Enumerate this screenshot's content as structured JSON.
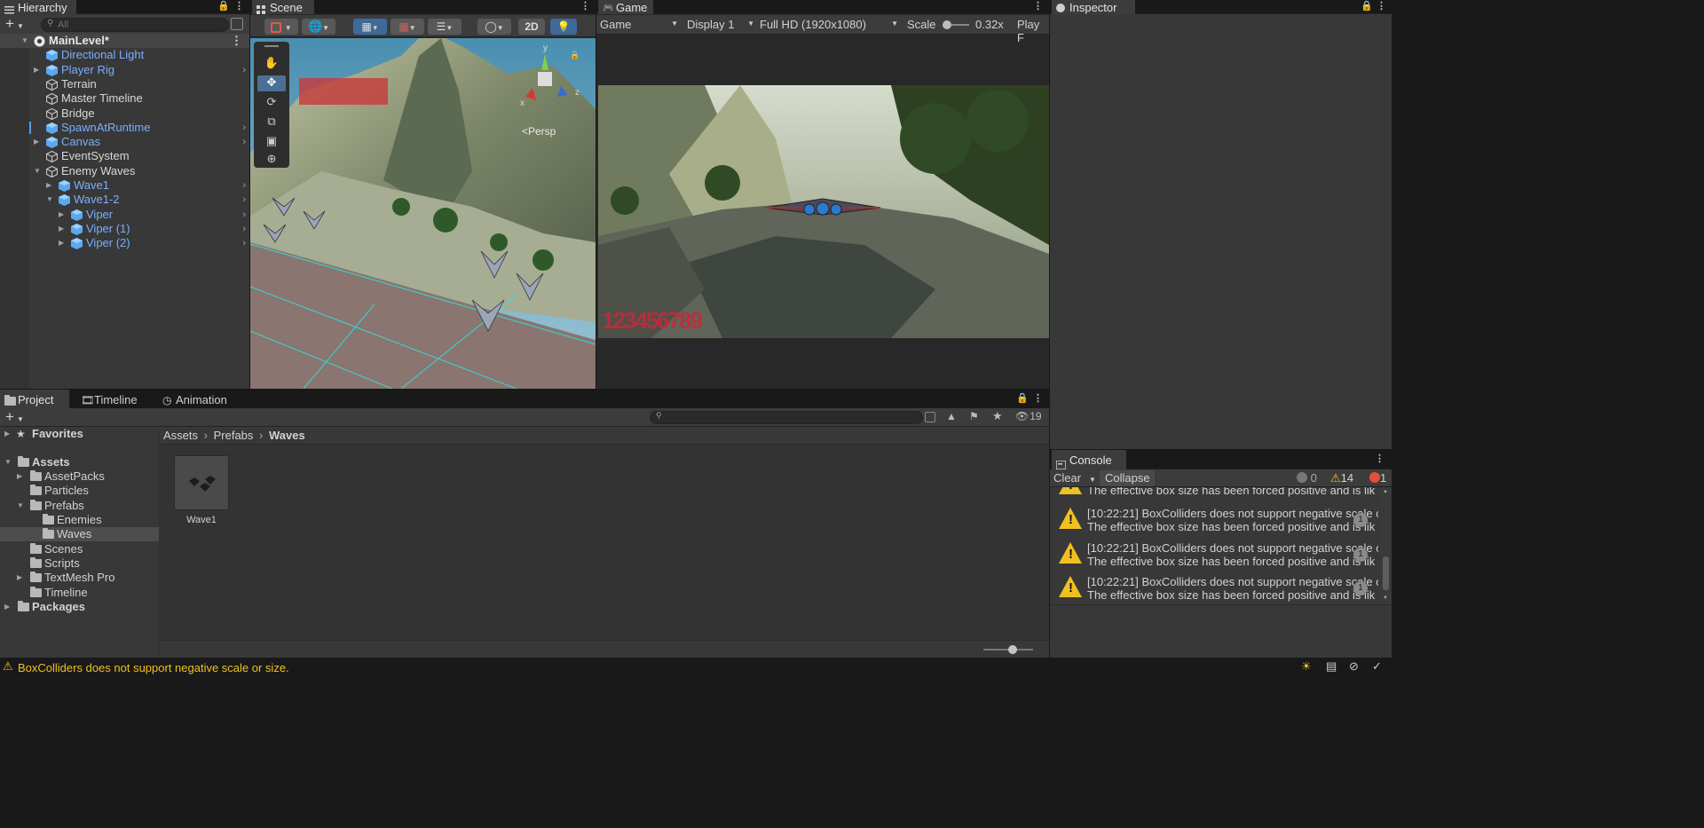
{
  "hierarchy": {
    "tab_label": "Hierarchy",
    "search_placeholder": "All",
    "add_label": "+",
    "items": [
      {
        "label": "MainLevel*",
        "color": "white"
      },
      {
        "label": "Directional Light",
        "color": "blue"
      },
      {
        "label": "Player Rig",
        "color": "blue"
      },
      {
        "label": "Terrain",
        "color": "white"
      },
      {
        "label": "Master Timeline",
        "color": "white"
      },
      {
        "label": "Bridge",
        "color": "white"
      },
      {
        "label": "SpawnAtRuntime",
        "color": "blue"
      },
      {
        "label": "Canvas",
        "color": "blue"
      },
      {
        "label": "EventSystem",
        "color": "white"
      },
      {
        "label": "Enemy Waves",
        "color": "white"
      },
      {
        "label": "Wave1",
        "color": "blue"
      },
      {
        "label": "Wave1-2",
        "color": "blue"
      },
      {
        "label": "Viper",
        "color": "blue"
      },
      {
        "label": "Viper (1)",
        "color": "blue"
      },
      {
        "label": "Viper (2)",
        "color": "blue"
      }
    ]
  },
  "scene": {
    "tab_label": "Scene",
    "btn_2d": "2D",
    "gizmo_persp": "<Persp",
    "gizmo_y": "y",
    "gizmo_x": "x",
    "gizmo_z": "z"
  },
  "game": {
    "tab_label": "Game",
    "mode": "Game",
    "display": "Display 1",
    "resolution": "Full HD (1920x1080)",
    "scale_label": "Scale",
    "scale_value": "0.32x",
    "play_label": "Play F",
    "hud_numbers": "123456789"
  },
  "inspector": {
    "tab_label": "Inspector"
  },
  "project": {
    "tabs": [
      "Project",
      "Timeline",
      "Animation"
    ],
    "hidden_count": "19",
    "favorites": "Favorites",
    "tree": [
      {
        "label": "Assets",
        "bold": true
      },
      {
        "label": "AssetPacks"
      },
      {
        "label": "Particles"
      },
      {
        "label": "Prefabs"
      },
      {
        "label": "Enemies"
      },
      {
        "label": "Waves"
      },
      {
        "label": "Scenes"
      },
      {
        "label": "Scripts"
      },
      {
        "label": "TextMesh Pro"
      },
      {
        "label": "Timeline"
      },
      {
        "label": "Packages",
        "bold": true
      }
    ],
    "breadcrumb": [
      "Assets",
      "Prefabs",
      "Waves"
    ],
    "asset_label": "Wave1"
  },
  "console": {
    "tab_label": "Console",
    "clear_label": "Clear",
    "collapse_label": "Collapse",
    "info_count": "0",
    "warn_count": "14",
    "error_count": "1",
    "top_partial": "The effective box size has been forced positive and is lik",
    "entries": [
      {
        "line1": "[10:22:21] BoxColliders does not support negative scale o",
        "line2": "The effective box size has been forced positive and is lik",
        "count": "1"
      },
      {
        "line1": "[10:22:21] BoxColliders does not support negative scale o",
        "line2": "The effective box size has been forced positive and is lik",
        "count": "1"
      },
      {
        "line1": "[10:22:21] BoxColliders does not support negative scale o",
        "line2": "The effective box size has been forced positive and is lik",
        "count": "1"
      }
    ]
  },
  "status": {
    "message": "BoxColliders does not support negative scale or size."
  },
  "colors": {
    "accent_blue": "#7aaeff",
    "selection": "#2c5d87",
    "warning": "#f0c020",
    "error": "#e0503c",
    "hud_red": "#c8283a"
  }
}
